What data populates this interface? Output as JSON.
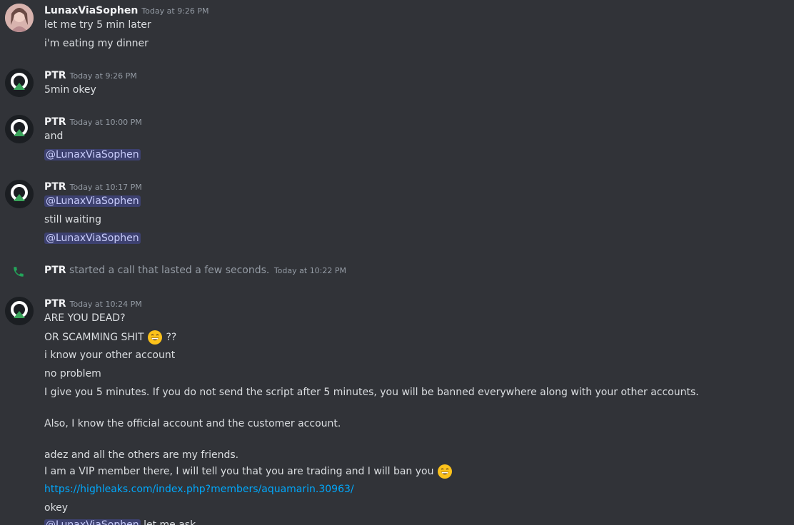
{
  "messages": [
    {
      "author": "LunaxViaSophen",
      "time": "Today at 9:26 PM",
      "lines": [
        "let me try 5 min later",
        "i'm eating my dinner"
      ]
    },
    {
      "author": "PTR",
      "time": "Today at 9:26 PM",
      "lines": [
        "5min okey"
      ]
    },
    {
      "author": "PTR",
      "time": "Today at 10:00 PM",
      "lines": [
        "and",
        "@LunaxViaSophen"
      ]
    },
    {
      "author": "PTR",
      "time": "Today at 10:17 PM",
      "lines": [
        "@LunaxViaSophen",
        "still waiting",
        "@LunaxViaSophen"
      ]
    },
    {
      "call": {
        "author": "PTR",
        "text": "started a call that lasted a few seconds.",
        "time": "Today at 10:22 PM"
      }
    },
    {
      "author": "PTR",
      "time": "Today at 10:24 PM",
      "lines": [
        "ARE YOU DEAD?",
        "OR SCAMMING SHIT",
        "??",
        "i know your other account",
        "no problem",
        "I give you 5 minutes. If you do not send the script after 5 minutes, you will be banned everywhere along with your other accounts.",
        "Also, I know the official account and the customer account.",
        "adez and all the others are my friends.",
        "I am a VIP member there, I will tell you that you are trading and I will ban you",
        "https://highleaks.com/index.php?members/aquamarin.30963/",
        "okey",
        "@LunaxViaSophen",
        "let me ask"
      ]
    }
  ],
  "colors": {
    "background": "#313338",
    "mention_bg": "#3c4270",
    "link": "#00a8fc",
    "call_icon": "#23a55a"
  },
  "icons": {
    "call": "phone-icon",
    "emoji": "grinning-face-emoji"
  }
}
